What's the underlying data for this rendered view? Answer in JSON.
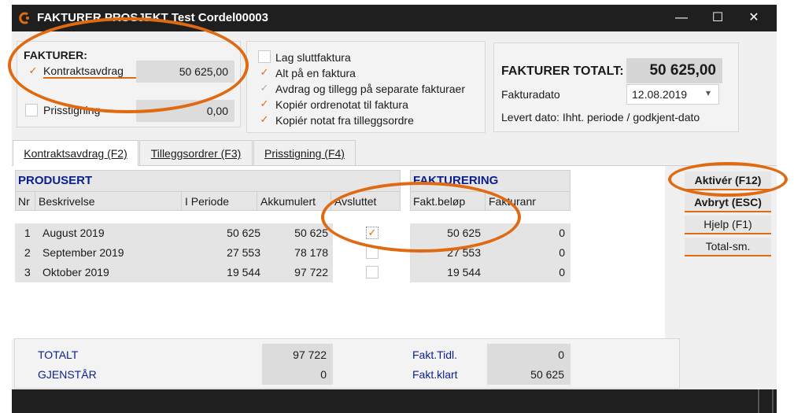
{
  "window": {
    "title": "FAKTURER PROSJEKT Test Cordel00003",
    "minimize_glyph": "—",
    "maximize_glyph": "☐",
    "close_glyph": "✕"
  },
  "fakturer_panel": {
    "heading": "FAKTURER:",
    "kontraktsavdrag_label": "Kontraktsavdrag",
    "kontraktsavdrag_value": "50 625,00",
    "kontraktsavdrag_checked": "✓",
    "prisstigning_label": "Prisstigning",
    "prisstigning_value": "0,00"
  },
  "options": [
    {
      "label": "Lag sluttfaktura",
      "check": ""
    },
    {
      "label": "Alt på en faktura",
      "check": "✓"
    },
    {
      "label": "Avdrag og tillegg på separate fakturaer",
      "check": "✓"
    },
    {
      "label": "Kopiér ordrenotat til faktura",
      "check": "✓"
    },
    {
      "label": "Kopiér notat fra tilleggsordre",
      "check": "✓"
    }
  ],
  "totals_panel": {
    "heading": "FAKTURER TOTALT:",
    "total_value": "50 625,00",
    "fakturadato_label": "Fakturadato",
    "fakturadato_value": "12.08.2019",
    "dropdown_glyph": "▾",
    "levert_text": "Levert dato: Ihht. periode / godkjent-dato"
  },
  "tabs": [
    {
      "label": "Kontraktsavdrag (F2)"
    },
    {
      "label": "Tilleggsordrer (F3)"
    },
    {
      "label": "Prisstigning (F4)"
    }
  ],
  "produsert": {
    "heading": "PRODUSERT",
    "columns": [
      "Nr",
      "Beskrivelse",
      "I Periode",
      "Akkumulert",
      "Avsluttet"
    ]
  },
  "fakturering": {
    "heading": "FAKTURERING",
    "columns": [
      "Fakt.beløp",
      "Fakturanr"
    ]
  },
  "rows": [
    {
      "nr": "1",
      "beskrivelse": "August 2019",
      "i_periode": "50 625",
      "akkumulert": "50 625",
      "avsluttet": "✓",
      "fakt_belop": "50 625",
      "fakturanr": "0"
    },
    {
      "nr": "2",
      "beskrivelse": "September 2019",
      "i_periode": "27 553",
      "akkumulert": "78 178",
      "avsluttet": "",
      "fakt_belop": "27 553",
      "fakturanr": "0"
    },
    {
      "nr": "3",
      "beskrivelse": "Oktober 2019",
      "i_periode": "19 544",
      "akkumulert": "97 722",
      "avsluttet": "",
      "fakt_belop": "19 544",
      "fakturanr": "0"
    }
  ],
  "buttons": {
    "aktiver": "Aktivér (F12)",
    "avbryt": "Avbryt (ESC)",
    "hjelp": "Hjelp (F1)",
    "totalsm": "Total-sm."
  },
  "summary": {
    "totalt_label": "TOTALT",
    "totalt_value": "97 722",
    "gjenstar_label": "GJENSTÅR",
    "gjenstar_value": "0",
    "fakt_tidl_label": "Fakt.Tidl.",
    "fakt_tidl_value": "0",
    "fakt_klart_label": "Fakt.klart",
    "fakt_klart_value": "50 625"
  },
  "colors": {
    "accent": "#e06a12",
    "navy": "#0a1f8f",
    "titlebar": "#1f1f1f"
  }
}
